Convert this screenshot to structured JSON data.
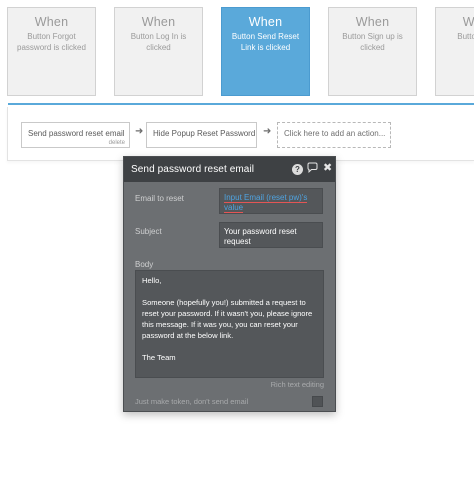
{
  "cards": [
    {
      "when": "When",
      "desc": "Button Forgot password is clicked",
      "active": false
    },
    {
      "when": "When",
      "desc": "Button Log In is clicked",
      "active": false
    },
    {
      "when": "When",
      "desc": "Button Send Reset Link is clicked",
      "active": true
    },
    {
      "when": "When",
      "desc": "Button Sign up is clicked",
      "active": false
    },
    {
      "when": "When",
      "desc": "Button Sw is",
      "active": false
    }
  ],
  "actions": {
    "step1": "Send password reset email",
    "step1_delete": "delete",
    "step2": "Hide Popup Reset Password",
    "add": "Click here to add an action..."
  },
  "popup": {
    "title": "Send password reset email",
    "help_glyph": "?",
    "email_label": "Email to reset",
    "email_value": "Input Email (reset pw)'s value",
    "subject_label": "Subject",
    "subject_value": "Your password reset request",
    "body_label": "Body",
    "body_text": "Hello,\n\nSomeone (hopefully you!) submitted a request to reset your password. If it wasn't you, please ignore this message. If it was you, you can reset your password at the below link.\n\nThe Team",
    "rich_text": "Rich text editing",
    "token_label": "Just make token, don't send email"
  },
  "colors": {
    "accent": "#5aa9da",
    "popup_bg": "#6c6f72",
    "header_bg": "#3e4144",
    "dynamic_text": "#4fa3e0"
  }
}
